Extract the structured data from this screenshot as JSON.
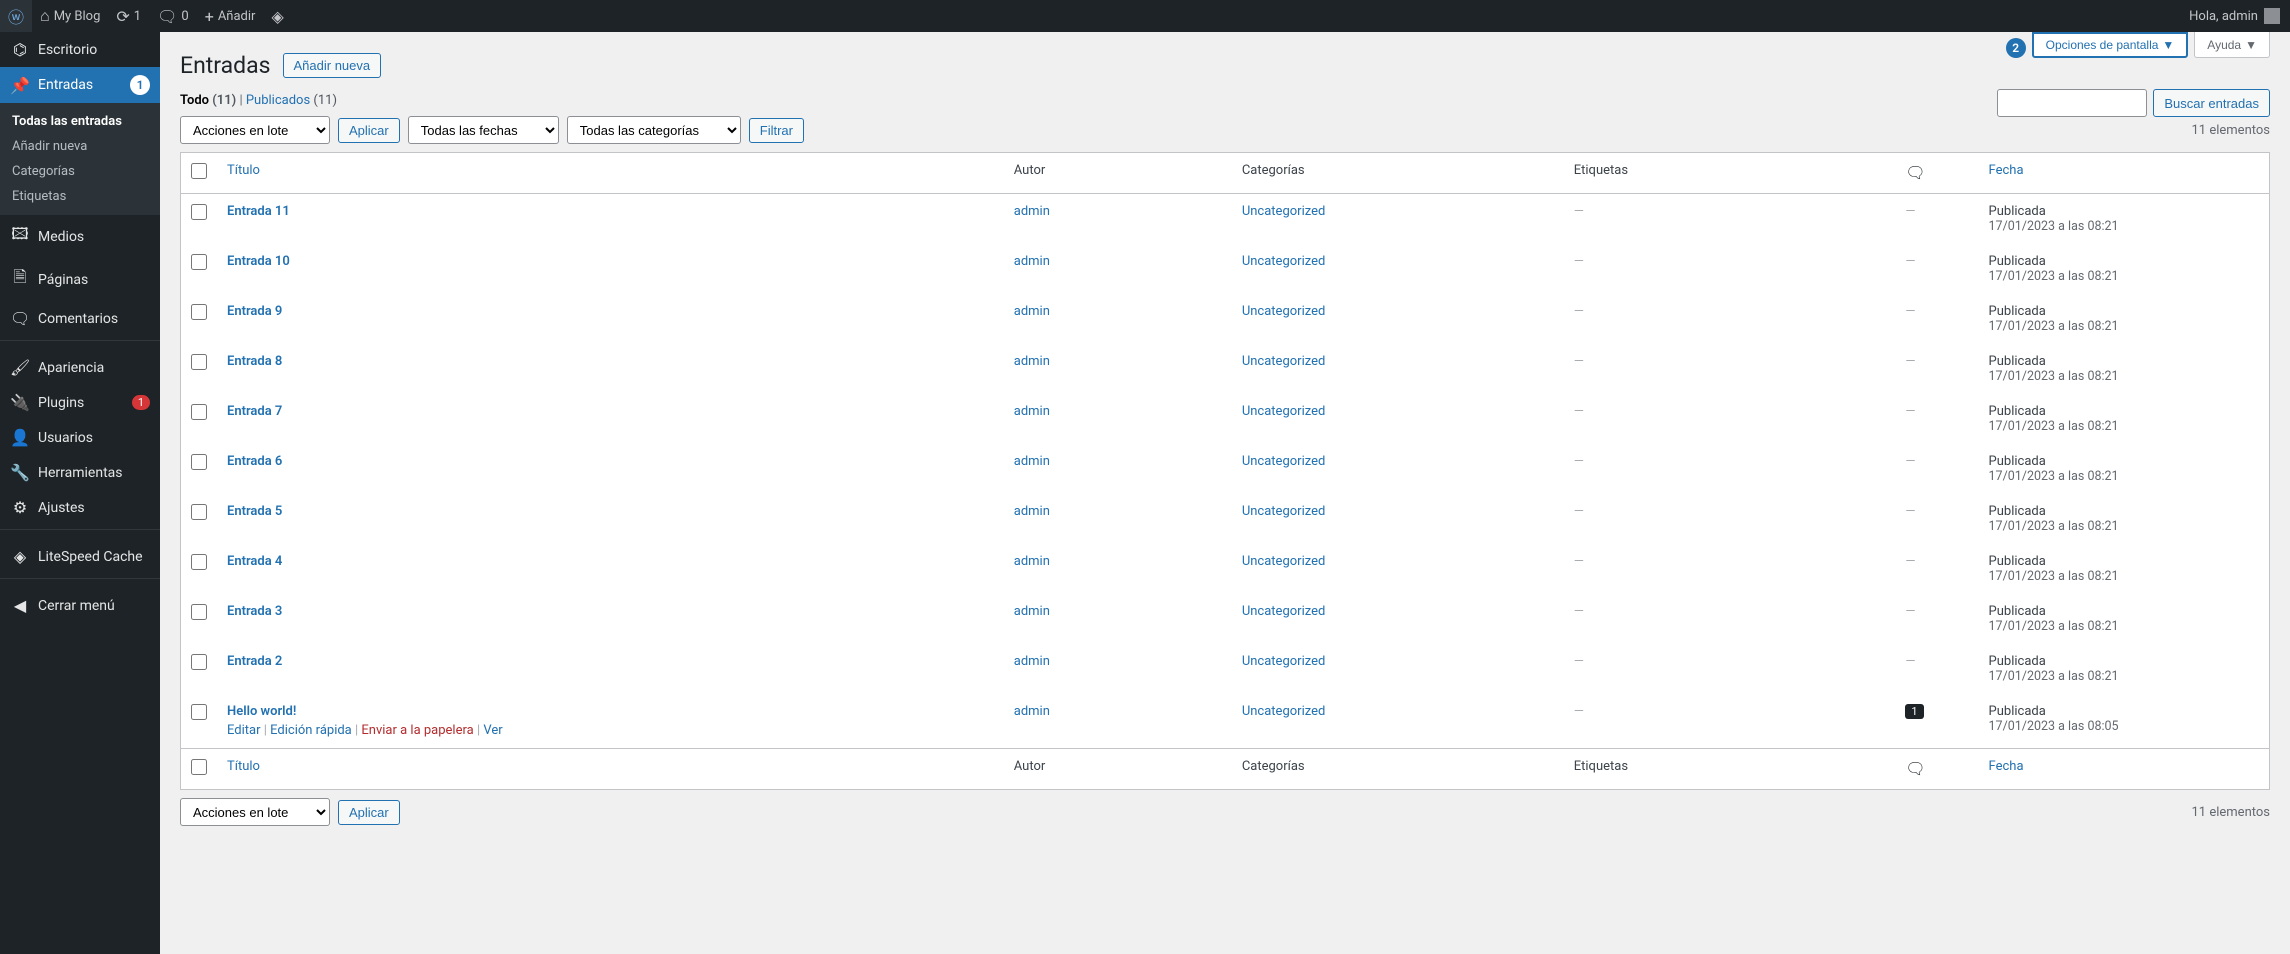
{
  "adminbar": {
    "site": "My Blog",
    "updates": "1",
    "comments": "0",
    "new": "Añadir",
    "greeting": "Hola, admin"
  },
  "callouts": {
    "one": "1",
    "two": "2"
  },
  "sidebar": {
    "items": [
      {
        "label": "Escritorio"
      },
      {
        "label": "Entradas",
        "badge": "1"
      },
      {
        "label": "Medios"
      },
      {
        "label": "Páginas"
      },
      {
        "label": "Comentarios"
      },
      {
        "label": "Apariencia"
      },
      {
        "label": "Plugins",
        "badge": "1"
      },
      {
        "label": "Usuarios"
      },
      {
        "label": "Herramientas"
      },
      {
        "label": "Ajustes"
      },
      {
        "label": "LiteSpeed Cache"
      },
      {
        "label": "Cerrar menú"
      }
    ],
    "submenu": [
      "Todas las entradas",
      "Añadir nueva",
      "Categorías",
      "Etiquetas"
    ]
  },
  "heading": {
    "title": "Entradas",
    "add": "Añadir nueva"
  },
  "screen_meta": {
    "options": "Opciones de pantalla",
    "help": "Ayuda"
  },
  "subsubsub": {
    "all": "Todo",
    "all_count": "(11)",
    "pub": "Publicados",
    "pub_count": "(11)"
  },
  "search": {
    "button": "Buscar entradas"
  },
  "tablenav": {
    "bulk": "Acciones en lote",
    "apply": "Aplicar",
    "dates": "Todas las fechas",
    "cats": "Todas las categorías",
    "filter": "Filtrar",
    "num": "11 elementos"
  },
  "table": {
    "cols": {
      "title": "Título",
      "author": "Autor",
      "cat": "Categorías",
      "tag": "Etiquetas",
      "date": "Fecha"
    },
    "status": "Publicada",
    "rows": [
      {
        "title": "Entrada 11",
        "author": "admin",
        "cat": "Uncategorized",
        "date": "17/01/2023 a las 08:21"
      },
      {
        "title": "Entrada 10",
        "author": "admin",
        "cat": "Uncategorized",
        "date": "17/01/2023 a las 08:21"
      },
      {
        "title": "Entrada 9",
        "author": "admin",
        "cat": "Uncategorized",
        "date": "17/01/2023 a las 08:21"
      },
      {
        "title": "Entrada 8",
        "author": "admin",
        "cat": "Uncategorized",
        "date": "17/01/2023 a las 08:21"
      },
      {
        "title": "Entrada 7",
        "author": "admin",
        "cat": "Uncategorized",
        "date": "17/01/2023 a las 08:21"
      },
      {
        "title": "Entrada 6",
        "author": "admin",
        "cat": "Uncategorized",
        "date": "17/01/2023 a las 08:21"
      },
      {
        "title": "Entrada 5",
        "author": "admin",
        "cat": "Uncategorized",
        "date": "17/01/2023 a las 08:21"
      },
      {
        "title": "Entrada 4",
        "author": "admin",
        "cat": "Uncategorized",
        "date": "17/01/2023 a las 08:21"
      },
      {
        "title": "Entrada 3",
        "author": "admin",
        "cat": "Uncategorized",
        "date": "17/01/2023 a las 08:21"
      },
      {
        "title": "Entrada 2",
        "author": "admin",
        "cat": "Uncategorized",
        "date": "17/01/2023 a las 08:21"
      },
      {
        "title": "Hello world!",
        "author": "admin",
        "cat": "Uncategorized",
        "date": "17/01/2023 a las 08:05",
        "comments": "1",
        "hover": true
      }
    ],
    "actions": {
      "edit": "Editar",
      "quick": "Edición rápida",
      "trash": "Enviar a la papelera",
      "view": "Ver"
    }
  }
}
